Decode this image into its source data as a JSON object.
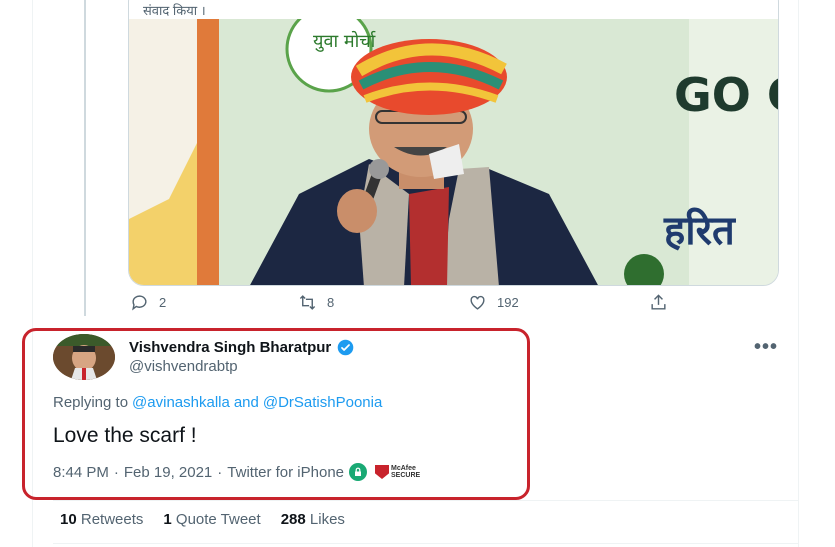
{
  "quoted_tweet": {
    "text_fragment": "संवाद किया ।"
  },
  "photo": {
    "banner_text_top": "युवा मोर्चा",
    "banner_text_right_1": "GO G",
    "banner_text_right_2": "हरित"
  },
  "actions": {
    "reply_count": "2",
    "retweet_count": "8",
    "like_count": "192"
  },
  "tweet": {
    "author_name": "Vishvendra Singh Bharatpur",
    "author_handle": "@vishvendrabtp",
    "replying_prefix": "Replying to",
    "mention_1": "@avinashkalla",
    "mention_joiner": "and",
    "mention_2": "@DrSatishPoonia",
    "text": "Love the scarf !",
    "time": "8:44 PM",
    "date": "Feb 19, 2021",
    "sep": "·",
    "client": "Twitter for iPhone",
    "mcafee_line1": "McAfee",
    "mcafee_line2": "SECURE",
    "more": "•••"
  },
  "stats": {
    "retweets_count": "10",
    "retweets_label": "Retweets",
    "quotes_count": "1",
    "quotes_label": "Quote Tweet",
    "likes_count": "288",
    "likes_label": "Likes"
  },
  "colors": {
    "accent": "#1d9bf0",
    "highlight": "#c8232c",
    "secondary_text": "#536471"
  }
}
